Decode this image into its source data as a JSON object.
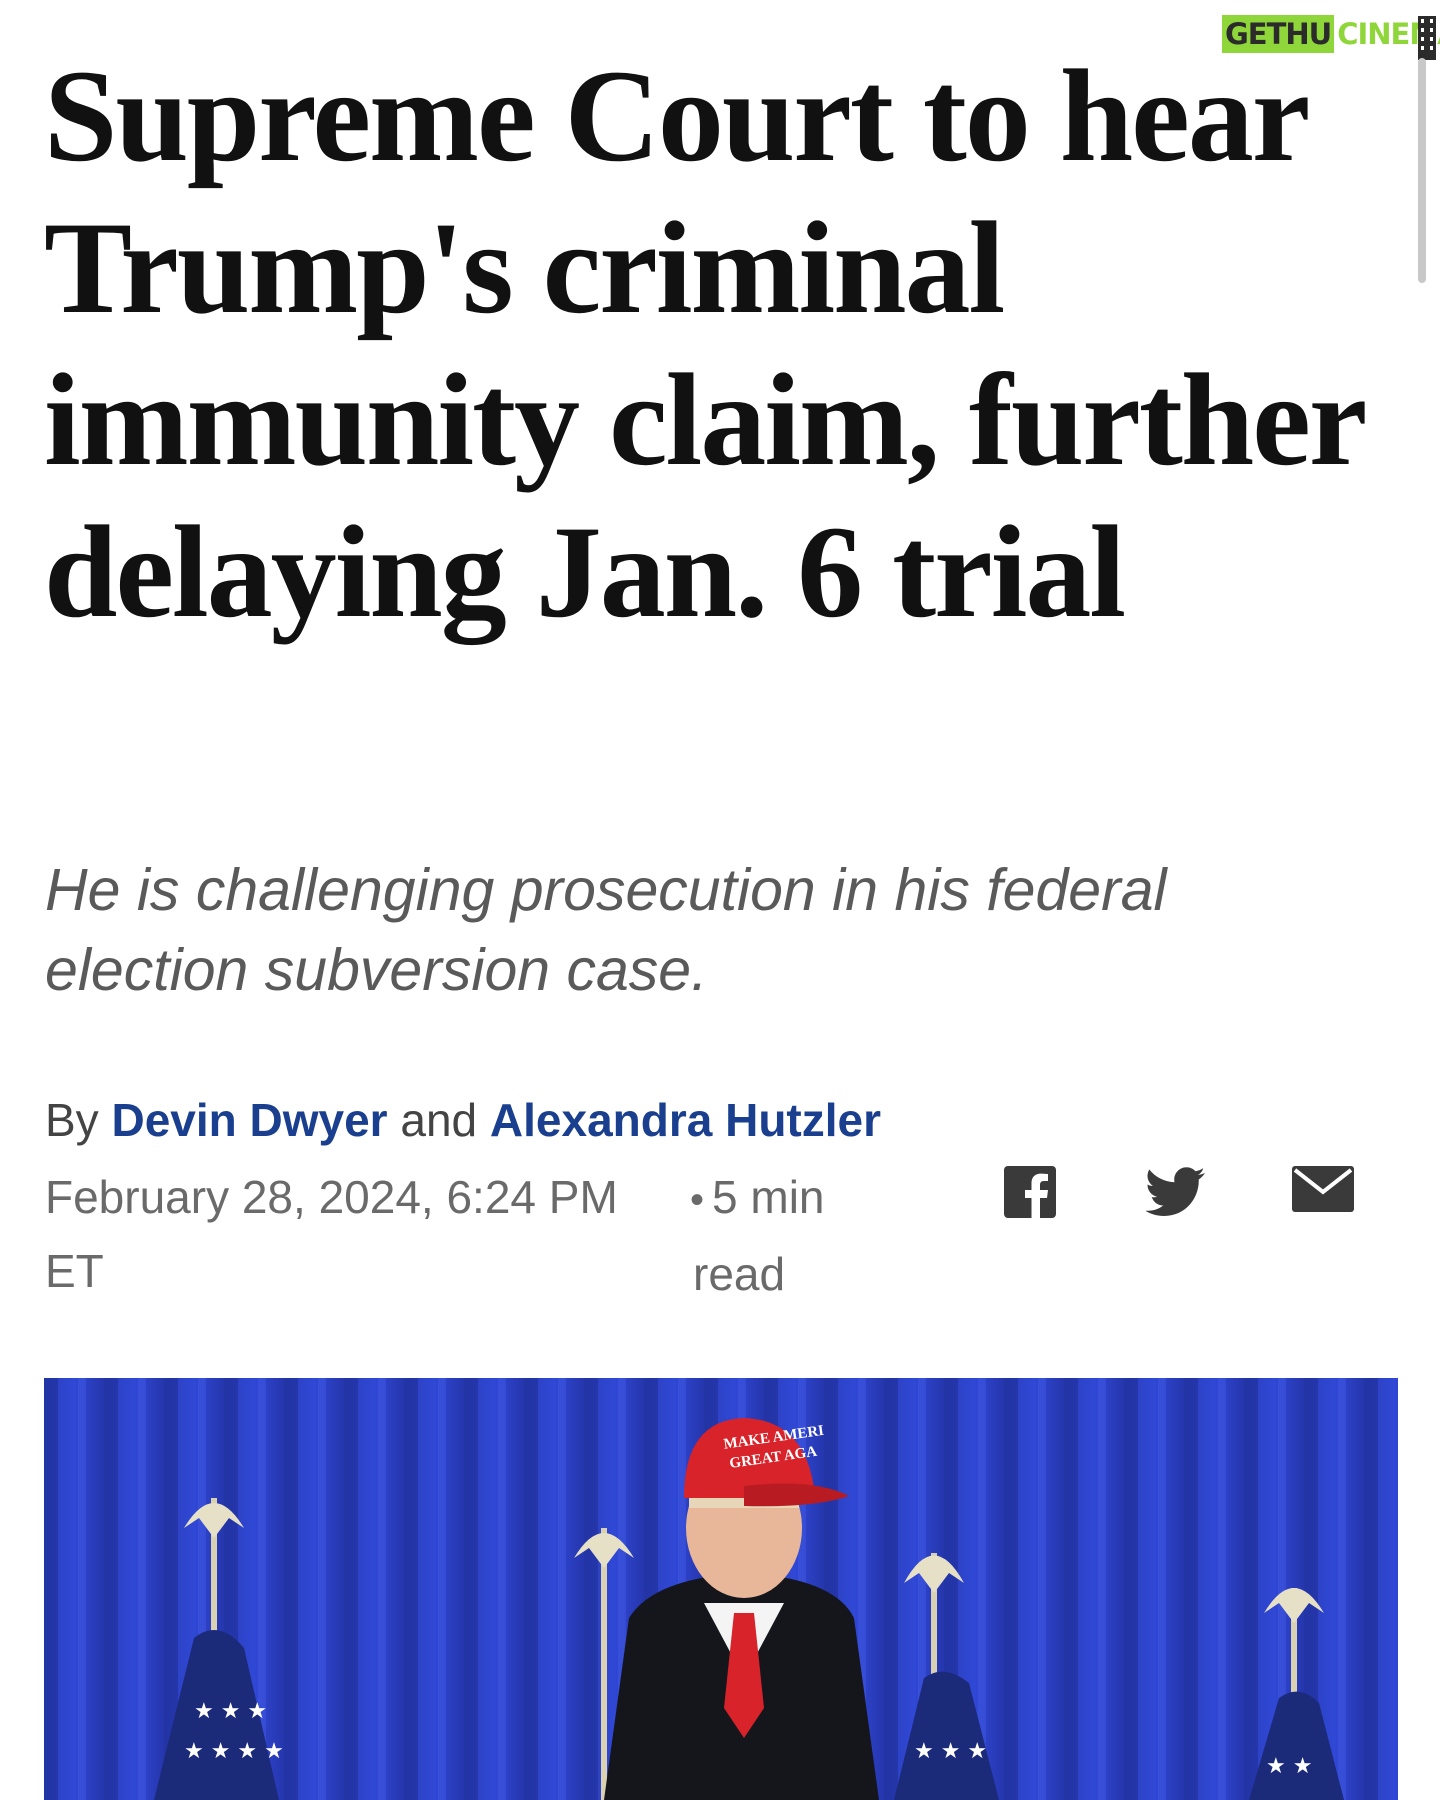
{
  "watermark": {
    "part1": "GETHU",
    "part2": "CINEMA"
  },
  "article": {
    "headline": "Supreme Court to hear Trump's criminal immunity claim, further delaying Jan. 6 trial",
    "dek": "He is challenging prosecution in his federal election subversion case.",
    "byline": {
      "prefix": "By",
      "author1": "Devin Dwyer",
      "conjunction": "and",
      "author2": "Alexandra Hutzler"
    },
    "date": "February 28, 2024, 6:24 PM ET",
    "read_time_separator": "•",
    "read_time_value": "5 min",
    "read_time_unit": "read"
  },
  "share": {
    "icons": [
      "facebook-icon",
      "twitter-icon",
      "email-icon"
    ],
    "icon_color": "#3a3a3a"
  },
  "photo": {
    "hat_line1": "MAKE AMERI",
    "hat_line2": "GREAT AGA",
    "curtain_color": "#2b3fc9",
    "hat_color": "#d8232a"
  },
  "colors": {
    "headline": "#111111",
    "author_link": "#1a3f8f",
    "dek": "#5a5a5a",
    "watermark_green": "#8fd63a"
  }
}
